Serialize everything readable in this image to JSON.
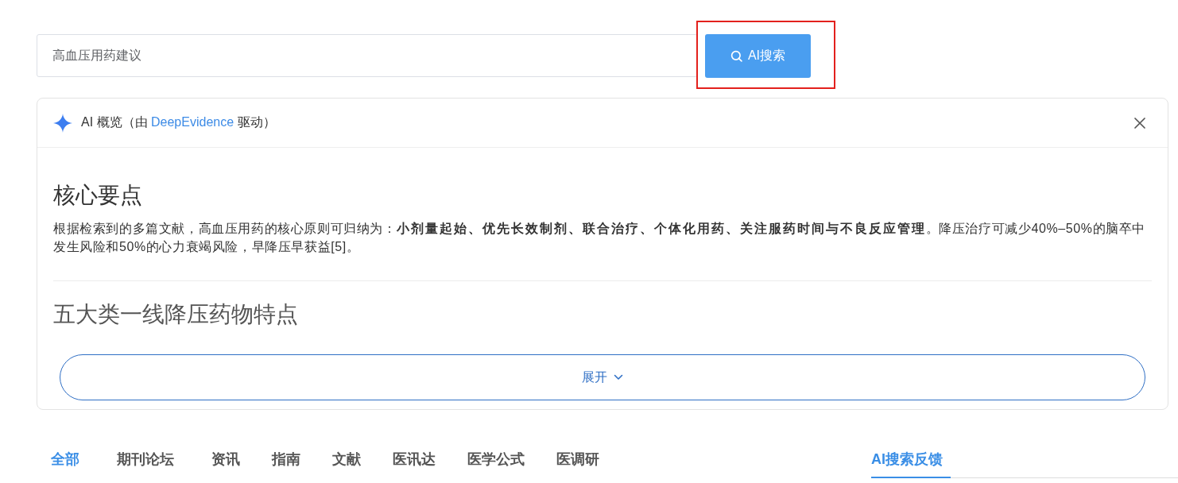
{
  "search": {
    "value": "高血压用药建议",
    "button": {
      "label": "AI搜索",
      "highlighted": true
    }
  },
  "overview": {
    "title_prefix": "AI 概览（由 ",
    "title_link": "DeepEvidence",
    "title_suffix": " 驱动）",
    "expanded": false,
    "sections": [
      {
        "heading": "核心要点",
        "text": "根据检索到的多篇文献，高血压用药的核心原则可归纳为：**小剂量起始、优先长效制剂、联合治疗、个体化用药、关注服药时间与不良反应管理**。降压治疗可减少40%–50%的脑卒中发生风险和50%的心力衰竭风险，早降压早获益[5]。"
      },
      {
        "heading": "五大类一线降压药物特点"
      }
    ],
    "expand_label": "展开"
  },
  "tabs": [
    {
      "label": "全部",
      "selected": true
    },
    {
      "label": "期刊论坛",
      "selected": false
    },
    {
      "label": "资讯",
      "selected": false
    },
    {
      "label": "指南",
      "selected": false
    },
    {
      "label": "文献",
      "selected": false
    },
    {
      "label": "医讯达",
      "selected": false
    },
    {
      "label": "医学公式",
      "selected": false
    },
    {
      "label": "医调研",
      "selected": false
    }
  ],
  "feedback_tab": {
    "label": "AI搜索反馈",
    "selected": true
  }
}
